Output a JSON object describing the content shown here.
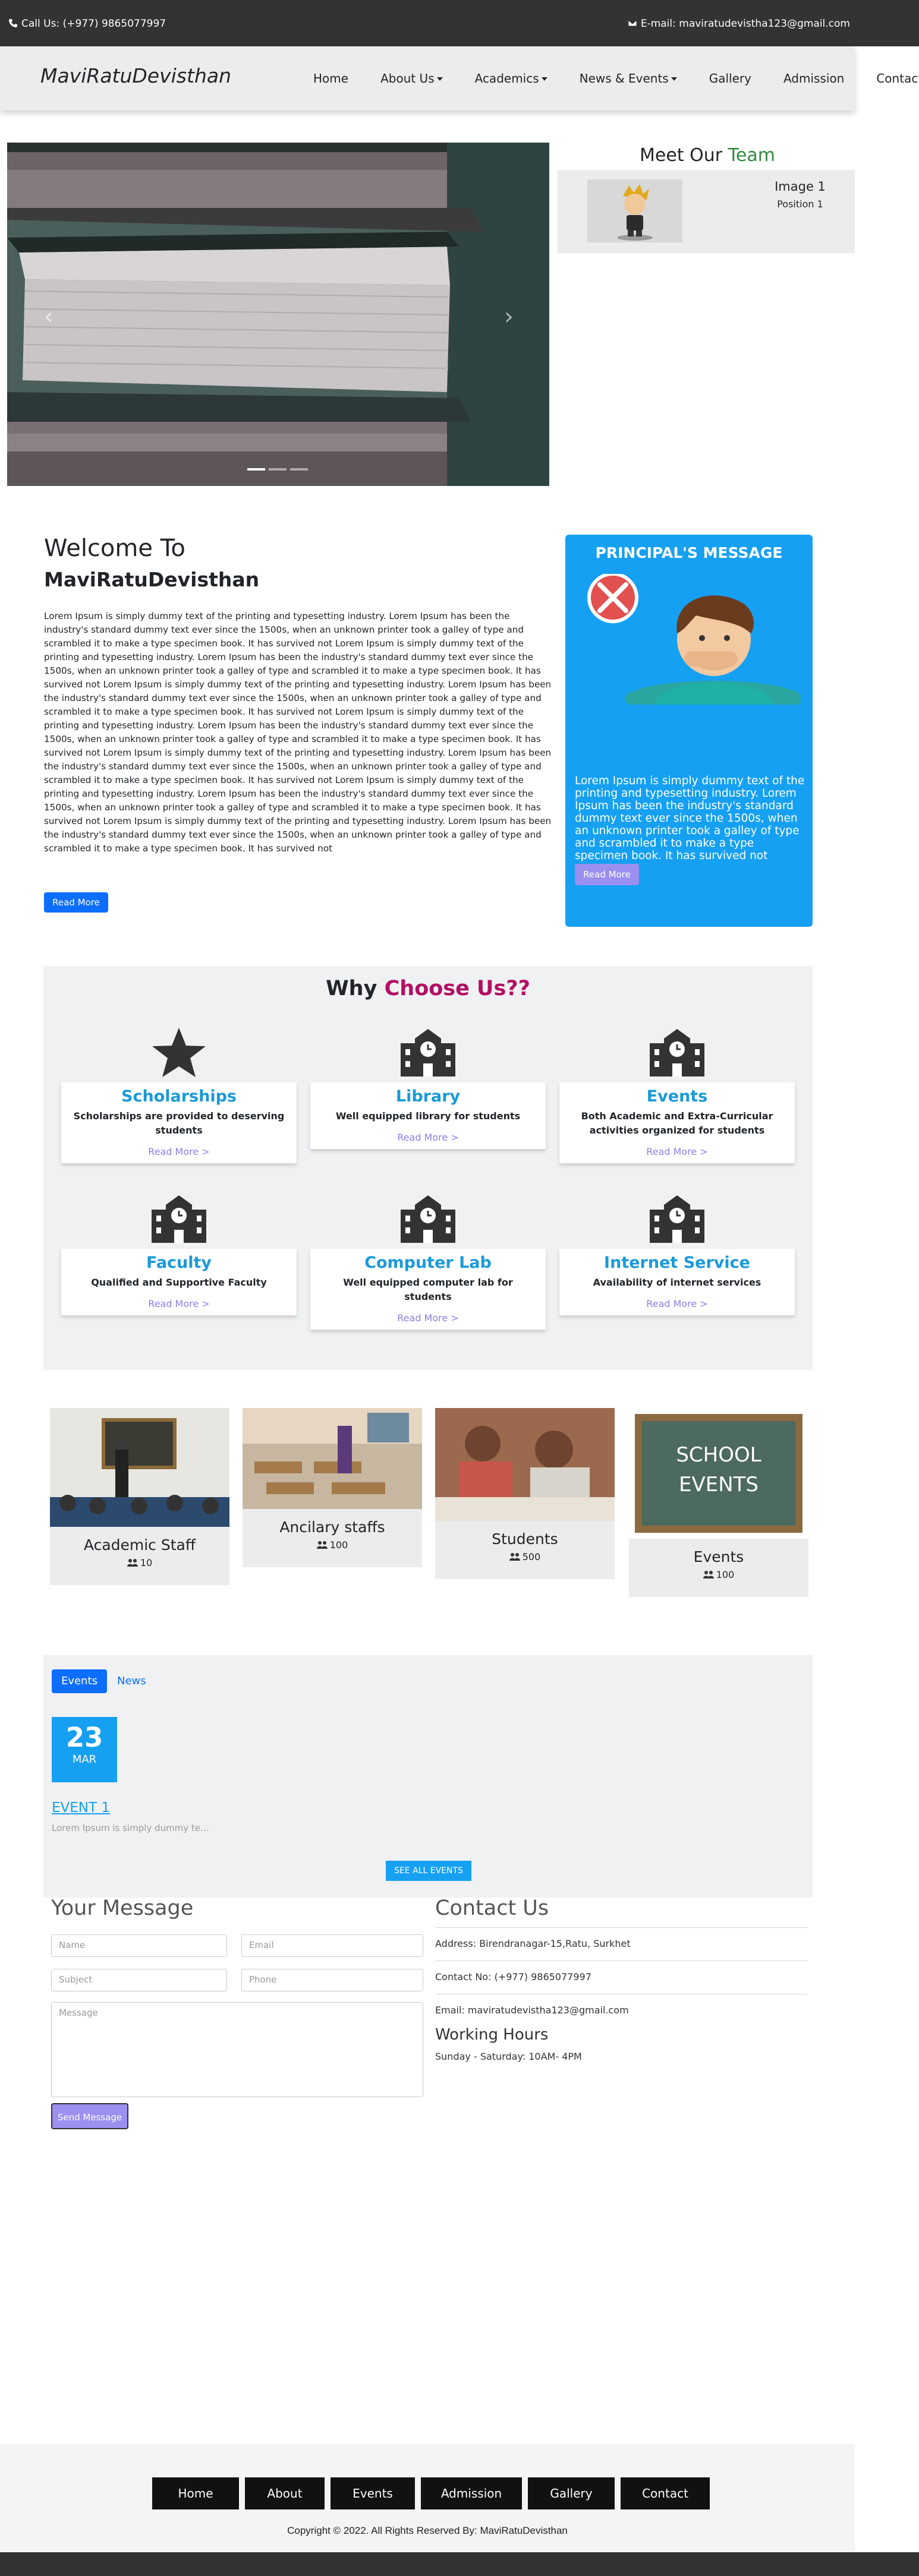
{
  "topbar": {
    "call": "Call Us: (+977) 9865077997",
    "email": "E-mail: maviratudevistha123@gmail.com"
  },
  "nav": {
    "brand": "MaviRatuDevisthan",
    "items": [
      {
        "label": "Home",
        "dropdown": false
      },
      {
        "label": "About Us",
        "dropdown": true
      },
      {
        "label": "Academics",
        "dropdown": true
      },
      {
        "label": "News & Events",
        "dropdown": true
      },
      {
        "label": "Gallery",
        "dropdown": false
      },
      {
        "label": "Admission",
        "dropdown": false
      },
      {
        "label": "Contact",
        "dropdown": false
      }
    ]
  },
  "carousel": {
    "prev": "‹",
    "next": "›",
    "slides": 3,
    "active": 1
  },
  "team": {
    "title_a": "Meet Our ",
    "title_b": "Team",
    "name": "Image 1",
    "position": "Position 1"
  },
  "welcome": {
    "heading": "Welcome To",
    "name": "MaviRatuDevisthan",
    "text": "Lorem Ipsum is simply dummy text of the printing and typesetting industry. Lorem Ipsum has been the industry's standard dummy text ever since the 1500s, when an unknown printer took a galley of type and scrambled it to make a type specimen book. It has survived not Lorem Ipsum is simply dummy text of the printing and typesetting industry. Lorem Ipsum has been the industry's standard dummy text ever since the 1500s, when an unknown printer took a galley of type and scrambled it to make a type specimen book. It has survived not Lorem Ipsum is simply dummy text of the printing and typesetting industry. Lorem Ipsum has been the industry's standard dummy text ever since the 1500s, when an unknown printer took a galley of type and scrambled it to make a type specimen book. It has survived not Lorem Ipsum is simply dummy text of the printing and typesetting industry. Lorem Ipsum has been the industry's standard dummy text ever since the 1500s, when an unknown printer took a galley of type and scrambled it to make a type specimen book. It has survived not Lorem Ipsum is simply dummy text of the printing and typesetting industry. Lorem Ipsum has been the industry's standard dummy text ever since the 1500s, when an unknown printer took a galley of type and scrambled it to make a type specimen book. It has survived not Lorem Ipsum is simply dummy text of the printing and typesetting industry. Lorem Ipsum has been the industry's standard dummy text ever since the 1500s, when an unknown printer took a galley of type and scrambled it to make a type specimen book. It has survived not Lorem Ipsum is simply dummy text of the printing and typesetting industry. Lorem Ipsum has been the industry's standard dummy text ever since the 1500s, when an unknown printer took a galley of type and scrambled it to make a type specimen book. It has survived not",
    "button": "Read More"
  },
  "principal": {
    "title": "PRINCIPAL'S MESSAGE",
    "text": "Lorem Ipsum is simply dummy text of the printing and typesetting industry. Lorem Ipsum has been the industry's standard dummy text ever since the 1500s, when an unknown printer took a galley of type and scrambled it to make a type specimen book. It has survived not",
    "button": "Read More"
  },
  "why": {
    "title_a": "Why ",
    "title_b": "Choose Us??",
    "features": [
      {
        "icon": "star-icon",
        "title": "Scholarships",
        "desc": "Scholarships are provided to deserving students",
        "more": "Read More >"
      },
      {
        "icon": "school-icon",
        "title": "Library",
        "desc": "Well equipped library for students",
        "more": "Read More >"
      },
      {
        "icon": "school-icon",
        "title": "Events",
        "desc": "Both Academic and Extra-Curricular activities organized for students",
        "more": "Read More >"
      },
      {
        "icon": "school-icon",
        "title": "Faculty",
        "desc": "Qualified and Supportive Faculty",
        "more": "Read More >"
      },
      {
        "icon": "school-icon",
        "title": "Computer Lab",
        "desc": "Well equipped computer lab for students",
        "more": "Read More >"
      },
      {
        "icon": "school-icon",
        "title": "Internet Service",
        "desc": "Availability of internet services",
        "more": "Read More >"
      }
    ]
  },
  "stats": [
    {
      "label": "Academic Staff",
      "count": "10"
    },
    {
      "label": "Ancilary staffs",
      "count": "100"
    },
    {
      "label": "Students",
      "count": "500"
    },
    {
      "label": "Events",
      "count": "100",
      "board_text_1": "SCHOOL",
      "board_text_2": "EVENTS"
    }
  ],
  "events": {
    "tab_events": "Events",
    "tab_news": "News",
    "day": "23",
    "month": "MAR",
    "title": "EVENT 1",
    "desc": "Lorem Ipsum is simply dummy te...",
    "see_all": "SEE ALL EVENTS"
  },
  "message": {
    "title": "Your Message",
    "name_ph": "Name",
    "email_ph": "Email",
    "subject_ph": "Subject",
    "phone_ph": "Phone",
    "message_ph": "Message",
    "send": "Send Message"
  },
  "contact": {
    "title": "Contact Us",
    "address": "Address: Birendranagar-15,Ratu, Surkhet",
    "phone": "Contact No: (+977) 9865077997",
    "email": "Email: maviratudevistha123@gmail.com",
    "hours_title": "Working Hours",
    "hours": "Sunday - Saturday: 10AM- 4PM"
  },
  "footer": {
    "links": [
      "Home",
      "About",
      "Events",
      "Admission",
      "Gallery",
      "Contact"
    ],
    "copyright": "Copyright © 2022. All Rights Reserved By: MaviRatuDevisthan"
  },
  "colors": {
    "accent_blue": "#16a0f2",
    "primary": "#0d6efd",
    "green": "#2e8b3e",
    "pink": "#b40e63",
    "dark": "#333333"
  }
}
